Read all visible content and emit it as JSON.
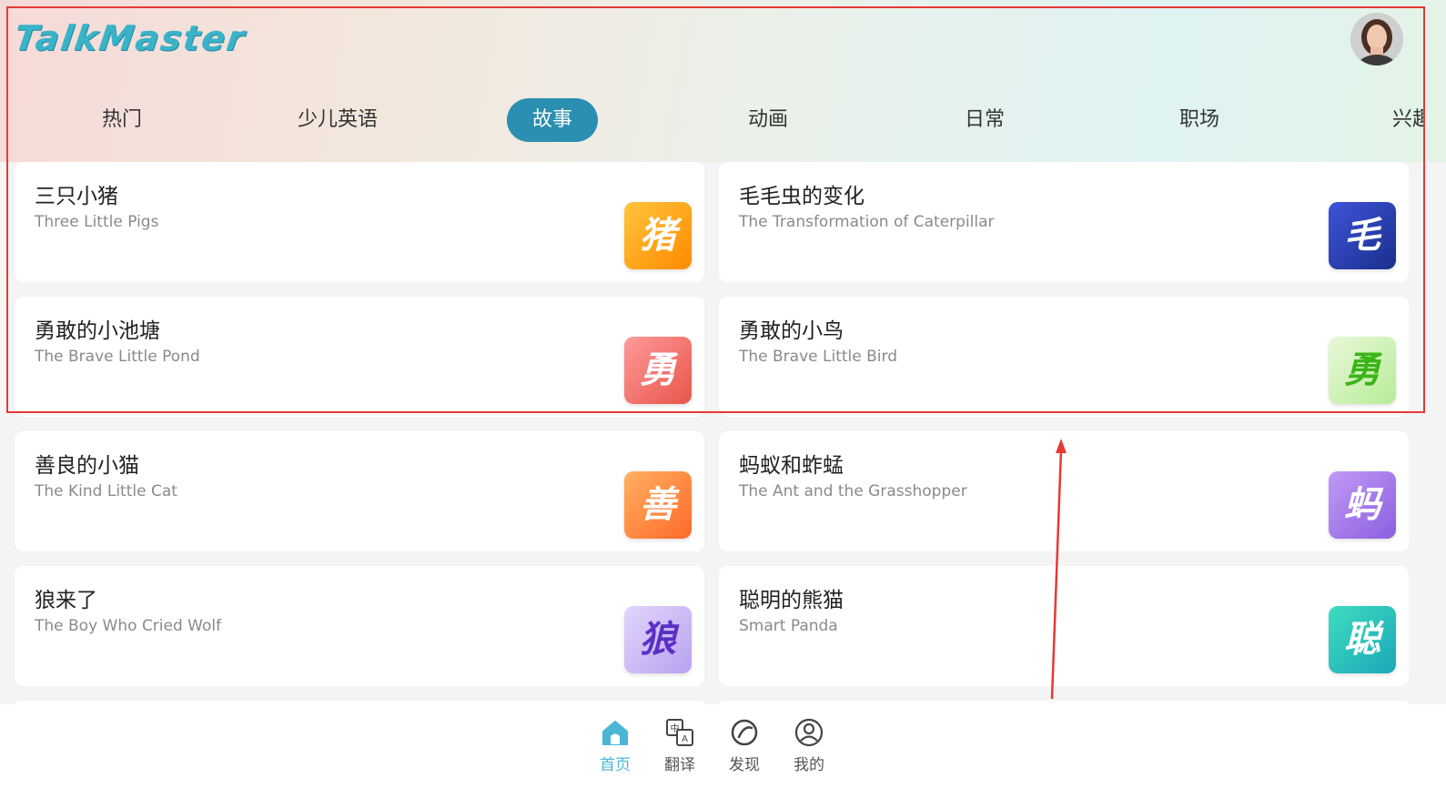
{
  "app": {
    "logo_text": "TalkMaster"
  },
  "tabs": [
    {
      "label": "热门",
      "active": false
    },
    {
      "label": "少儿英语",
      "active": false
    },
    {
      "label": "故事",
      "active": true
    },
    {
      "label": "动画",
      "active": false
    },
    {
      "label": "日常",
      "active": false
    },
    {
      "label": "职场",
      "active": false
    },
    {
      "label": "兴趣",
      "active": false
    }
  ],
  "stories": [
    {
      "cn": "三只小猪",
      "en": "Three Little Pigs",
      "glyph": "猪",
      "color_from": "#ffc53d",
      "color_to": "#ff8a00"
    },
    {
      "cn": "毛毛虫的变化",
      "en": "The Transformation of Caterpillar",
      "glyph": "毛",
      "color_from": "#3e54d9",
      "color_to": "#1a2f8c"
    },
    {
      "cn": "勇敢的小池塘",
      "en": "The Brave Little Pond",
      "glyph": "勇",
      "color_from": "#ff9a9a",
      "color_to": "#e8554a"
    },
    {
      "cn": "勇敢的小鸟",
      "en": "The Brave Little Bird",
      "glyph": "勇",
      "color_from": "#e8f8d8",
      "color_to": "#b8ec98",
      "glyph_color": "#3bb418"
    },
    {
      "cn": "善良的小猫",
      "en": "The Kind Little Cat",
      "glyph": "善",
      "color_from": "#ffb060",
      "color_to": "#ff6a2a"
    },
    {
      "cn": "蚂蚁和蚱蜢",
      "en": "The Ant and the Grasshopper",
      "glyph": "蚂",
      "color_from": "#c29af5",
      "color_to": "#8b5fe0"
    },
    {
      "cn": "狼来了",
      "en": "The Boy Who Cried Wolf",
      "glyph": "狼",
      "color_from": "#e2d6fb",
      "color_to": "#b7a2f0",
      "glyph_color": "#5b2fc4"
    },
    {
      "cn": "聪明的熊猫",
      "en": "Smart Panda",
      "glyph": "聪",
      "color_from": "#3fdcc0",
      "color_to": "#1aa8b8"
    }
  ],
  "bottom_nav": [
    {
      "label": "首页",
      "icon": "home-icon",
      "active": true
    },
    {
      "label": "翻译",
      "icon": "translate-icon",
      "active": false
    },
    {
      "label": "发现",
      "icon": "discover-icon",
      "active": false
    },
    {
      "label": "我的",
      "icon": "profile-icon",
      "active": false
    }
  ],
  "colors": {
    "accent": "#2a8fb0",
    "active_nav": "#49b6d6",
    "annotation": "#e53935"
  }
}
